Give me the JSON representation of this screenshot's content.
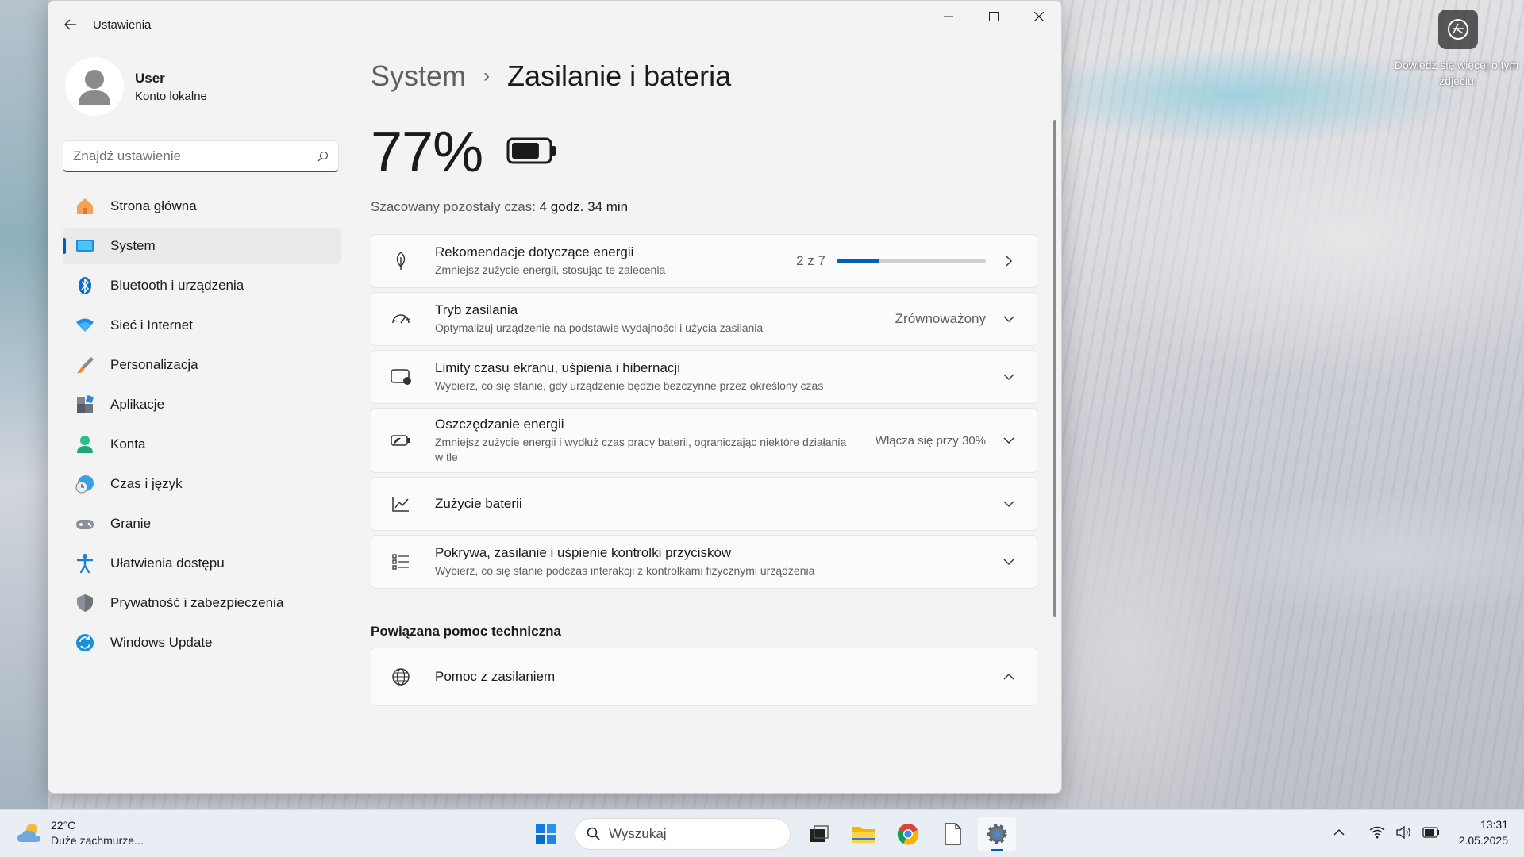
{
  "window": {
    "app_title": "Ustawienia"
  },
  "wallpaper": {
    "caption": "Dowiedz się więcej o tym zdjęciu"
  },
  "profile": {
    "name": "User",
    "account_type": "Konto lokalne"
  },
  "search": {
    "placeholder": "Znajdź ustawienie"
  },
  "nav": {
    "items": [
      {
        "label": "Strona główna",
        "icon": "home-icon",
        "active": false
      },
      {
        "label": "System",
        "icon": "system-icon",
        "active": true
      },
      {
        "label": "Bluetooth i urządzenia",
        "icon": "bluetooth-icon",
        "active": false
      },
      {
        "label": "Sieć i Internet",
        "icon": "wifi-icon",
        "active": false
      },
      {
        "label": "Personalizacja",
        "icon": "brush-icon",
        "active": false
      },
      {
        "label": "Aplikacje",
        "icon": "apps-icon",
        "active": false
      },
      {
        "label": "Konta",
        "icon": "account-icon",
        "active": false
      },
      {
        "label": "Czas i język",
        "icon": "time-language-icon",
        "active": false
      },
      {
        "label": "Granie",
        "icon": "gamepad-icon",
        "active": false
      },
      {
        "label": "Ułatwienia dostępu",
        "icon": "accessibility-icon",
        "active": false
      },
      {
        "label": "Prywatność i zabezpieczenia",
        "icon": "shield-icon",
        "active": false
      },
      {
        "label": "Windows Update",
        "icon": "update-icon",
        "active": false
      }
    ]
  },
  "breadcrumb": {
    "parent": "System",
    "separator": "›",
    "current": "Zasilanie i bateria"
  },
  "battery": {
    "percent": "77%",
    "level": 0.77,
    "estimate_label": "Szacowany pozostały czas:",
    "estimate_value": "4 godz. 34 min"
  },
  "cards": {
    "recommendations": {
      "title": "Rekomendacje dotyczące energii",
      "subtitle": "Zmniejsz zużycie energii, stosując te zalecenia",
      "progress_text": "2 z 7",
      "progress_value": 0.2857
    },
    "power_mode": {
      "title": "Tryb zasilania",
      "subtitle": "Optymalizuj urządzenie na podstawie wydajności i użycia zasilania",
      "value": "Zrównoważony"
    },
    "screen_sleep": {
      "title": "Limity czasu ekranu, uśpienia i hibernacji",
      "subtitle": "Wybierz, co się stanie, gdy urządzenie będzie bezczynne przez określony czas"
    },
    "energy_saver": {
      "title": "Oszczędzanie energii",
      "subtitle": "Zmniejsz zużycie energii i wydłuż czas pracy baterii, ograniczając niektóre działania w tle",
      "value": "Włącza się przy 30%"
    },
    "battery_usage": {
      "title": "Zużycie baterii"
    },
    "lid_power": {
      "title": "Pokrywa, zasilanie i uśpienie kontrolki przycisków",
      "subtitle": "Wybierz, co się stanie podczas interakcji z kontrolkami fizycznymi urządzenia"
    }
  },
  "related": {
    "section_title": "Powiązana pomoc techniczna",
    "help_title": "Pomoc z zasilaniem"
  },
  "taskbar": {
    "weather_temp": "22°C",
    "weather_desc": "Duże zachmurze...",
    "search_label": "Wyszukaj",
    "time": "13:31",
    "date": "2.05.2025"
  },
  "colors": {
    "accent": "#005fb8",
    "window_bg": "#f3f3f3",
    "card_bg": "#fbfbfb"
  }
}
